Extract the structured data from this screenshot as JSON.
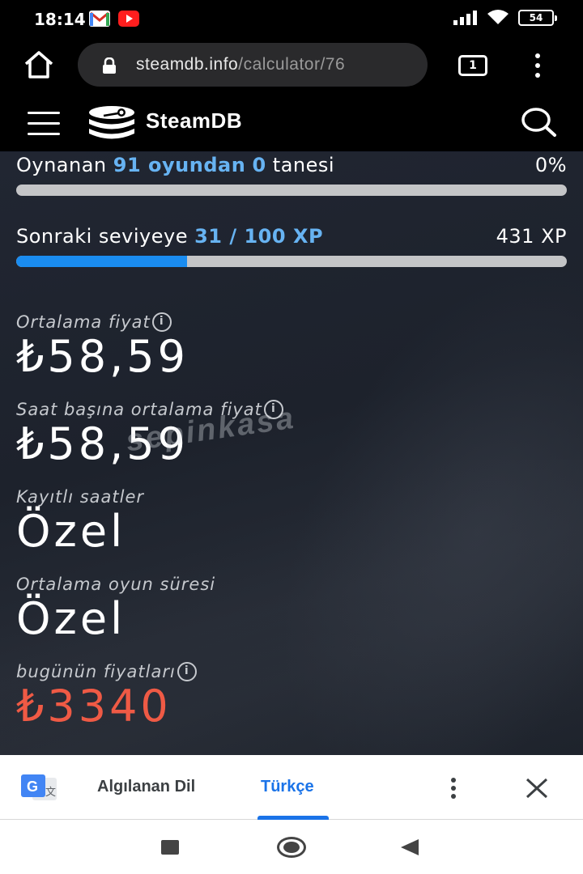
{
  "status_bar": {
    "time": "18:14",
    "battery": "54",
    "icons": [
      "gmail-icon",
      "youtube-icon",
      "signal-icon",
      "wifi-icon",
      "battery-icon"
    ]
  },
  "browser": {
    "url_domain": "steamdb.info",
    "url_path": "/calculator/76",
    "tab_count": "1"
  },
  "site": {
    "title": "SteamDB"
  },
  "progress": {
    "played": {
      "prefix": "Oynanan ",
      "total": "91 oyundan",
      "count": "0",
      "suffix": " tanesi",
      "percent_text": "0%",
      "fill_fraction": 0
    },
    "level": {
      "prefix": "Sonraki seviyeye ",
      "xp": "31 / 100 XP",
      "total_xp": "431 XP",
      "fill_fraction": 0.31
    }
  },
  "stats": [
    {
      "label": "Ortalama fiyat",
      "value": "₺58,59",
      "has_info": true
    },
    {
      "label": "Saat başına ortalama fiyat",
      "value": "₺58,59",
      "has_info": true
    },
    {
      "label": "Kayıtlı saatler",
      "value": "Özel",
      "has_info": false
    },
    {
      "label": "Ortalama oyun süresi",
      "value": "Özel",
      "has_info": false
    },
    {
      "label": "bugünün fiyatları",
      "value": "₺3340",
      "has_info": true
    }
  ],
  "watermark": "sepinkasa",
  "translate_bar": {
    "detected_label": "Algılanan Dil",
    "target_label": "Türkçe"
  },
  "colors": {
    "accent_blue": "#67b3f2",
    "progress_fill": "#1a8cf0",
    "price_red": "#ef5a45",
    "translate_blue": "#1a73e8"
  }
}
